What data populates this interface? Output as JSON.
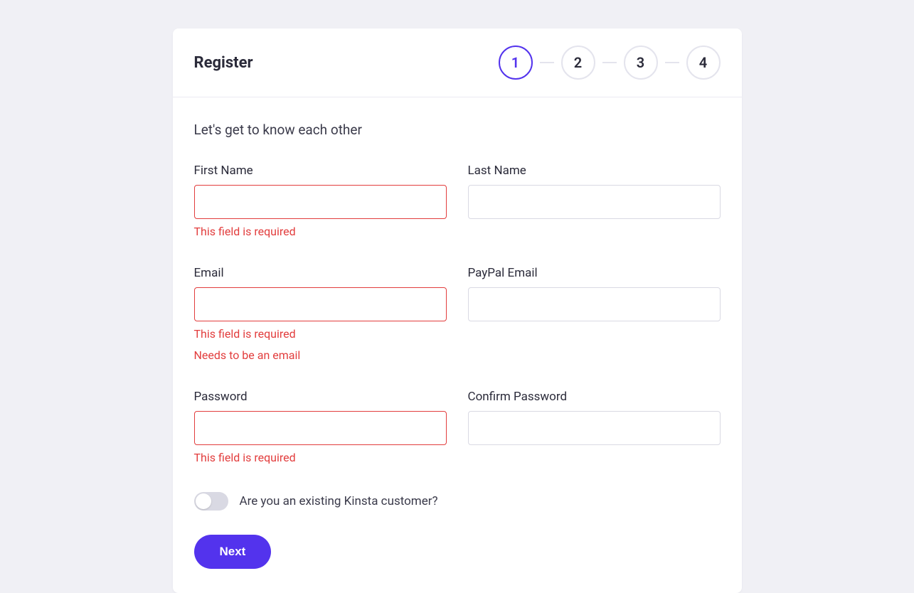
{
  "header": {
    "title": "Register",
    "steps": [
      "1",
      "2",
      "3",
      "4"
    ],
    "activeStep": 0
  },
  "form": {
    "lead": "Let's get to know each other",
    "fields": {
      "firstName": {
        "label": "First Name",
        "value": "",
        "errors": [
          "This field is required"
        ]
      },
      "lastName": {
        "label": "Last Name",
        "value": "",
        "errors": []
      },
      "email": {
        "label": "Email",
        "value": "",
        "errors": [
          "This field is required",
          "Needs to be an email"
        ]
      },
      "paypalEmail": {
        "label": "PayPal Email",
        "value": "",
        "errors": []
      },
      "password": {
        "label": "Password",
        "value": "",
        "errors": [
          "This field is required"
        ]
      },
      "confirmPassword": {
        "label": "Confirm Password",
        "value": "",
        "errors": []
      }
    },
    "toggle": {
      "label": "Are you an existing Kinsta customer?",
      "value": false
    },
    "nextButton": "Next"
  }
}
